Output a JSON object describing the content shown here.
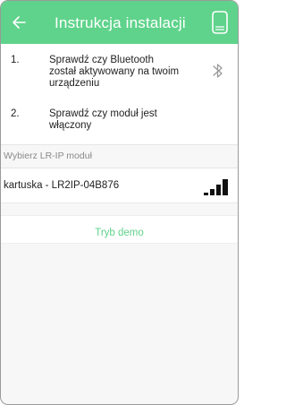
{
  "header": {
    "title": "Instrukcja instalacji",
    "back_icon": "arrow-left-icon",
    "doc_icon": "document-icon",
    "background_color": "#5fd38b"
  },
  "instructions": [
    {
      "number": "1.",
      "text": "Sprawdź czy Bluetooth został aktywowany na twoim urządzeniu",
      "icon": "bluetooth-icon"
    },
    {
      "number": "2.",
      "text": "Sprawdź czy moduł jest włączony"
    }
  ],
  "module_section": {
    "label": "Wybierz LR-IP moduł"
  },
  "devices": [
    {
      "name": "kartuska - LR2IP-04B876",
      "signal_icon": "signal-strength-icon",
      "signal_level": 1.0
    }
  ],
  "demo": {
    "label": "Tryb demo",
    "color": "#5fd38b"
  }
}
